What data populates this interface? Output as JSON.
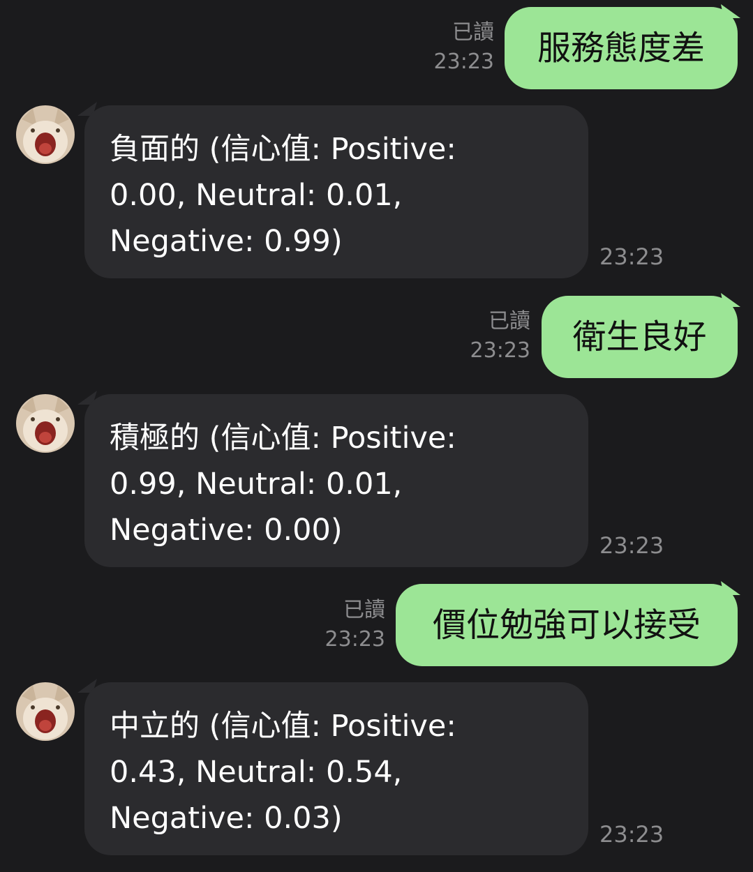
{
  "messages": [
    {
      "type": "outgoing",
      "read": "已讀",
      "time": "23:23",
      "text": "服務態度差"
    },
    {
      "type": "incoming",
      "time": "23:23",
      "lines": [
        "負面的 (信心值: Positive:",
        "0.00, Neutral: 0.01,",
        "Negative: 0.99)"
      ]
    },
    {
      "type": "outgoing",
      "read": "已讀",
      "time": "23:23",
      "text": "衛生良好"
    },
    {
      "type": "incoming",
      "time": "23:23",
      "lines": [
        "積極的 (信心值: Positive:",
        "0.99, Neutral: 0.01,",
        "Negative: 0.00)"
      ]
    },
    {
      "type": "outgoing",
      "read": "已讀",
      "time": "23:23",
      "text": "價位勉強可以接受"
    },
    {
      "type": "incoming",
      "time": "23:23",
      "lines": [
        "中立的 (信心值: Positive:",
        "0.43, Neutral: 0.54,",
        "Negative: 0.03)"
      ]
    }
  ],
  "avatar": {
    "icon": "cat-avatar-icon"
  },
  "colors": {
    "background": "#1b1b1d",
    "outgoing_bubble": "#9ce596",
    "incoming_bubble": "#2b2b2e",
    "meta_text": "#8d8d8f"
  }
}
